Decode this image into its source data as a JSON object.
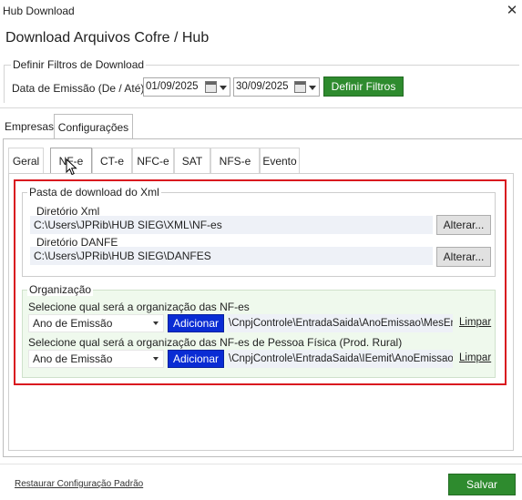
{
  "window": {
    "title": "Hub Download",
    "close_glyph": "✕"
  },
  "header": {
    "title": "Download Arquivos Cofre / Hub"
  },
  "filters": {
    "legend": "Definir Filtros de Download",
    "date_label": "Data de Emissão (De / Até):",
    "date_from": "01/09/2025",
    "date_to": "30/09/2025",
    "button": "Definir Filtros"
  },
  "main_tabs": [
    "Empresas",
    "Configurações"
  ],
  "sub_tabs": [
    "Geral",
    "NF-e",
    "CT-e",
    "NFC-e",
    "SAT",
    "NFS-e",
    "Evento"
  ],
  "xml_folder": {
    "legend": "Pasta de download do Xml",
    "xml_label": "Diretório Xml",
    "xml_path": "C:\\Users\\JPRib\\HUB SIEG\\XML\\NF-es",
    "danfe_label": "Diretório DANFE",
    "danfe_path": "C:\\Users\\JPRib\\HUB SIEG\\DANFES",
    "change_button": "Alterar..."
  },
  "organization": {
    "legend": "Organização",
    "label1": "Selecione qual será a organização das NF-es",
    "select1": "Ano de Emissão",
    "path1": "\\CnpjControle\\EntradaSaida\\AnoEmissao\\MesEmissao",
    "label2": "Selecione qual será a organização das NF-es de Pessoa Física (Prod. Rural)",
    "select2": "Ano de Emissão",
    "path2": "\\CnpjControle\\EntradaSaida\\IEemit\\AnoEmissao\\MesEmissao",
    "add_button": "Adicionar",
    "clear_link": "Limpar"
  },
  "footer": {
    "restore_link": "Restaurar Configuração Padrão",
    "save_button": "Salvar"
  },
  "colors": {
    "accent_green": "#2e8b2e",
    "accent_blue": "#0a2cd4",
    "highlight_red": "#d9181f"
  }
}
